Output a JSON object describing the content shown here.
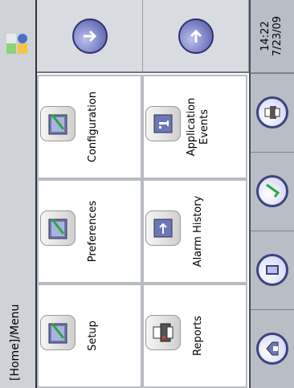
{
  "breadcrumb": {
    "text": "[Home]/Menu"
  },
  "menu": {
    "items": [
      {
        "label": "Setup",
        "icon": "setup-icon"
      },
      {
        "label": "Preferences",
        "icon": "preferences-icon"
      },
      {
        "label": "Configuration",
        "icon": "configuration-icon"
      },
      {
        "label": "Reports",
        "icon": "reports-icon"
      },
      {
        "label": "Alarm History",
        "icon": "alarm-history-icon"
      },
      {
        "label": "Application\nEvents",
        "icon": "application-events-icon"
      }
    ]
  },
  "side_nav": {
    "previous": "arrow-down-icon",
    "next": "arrow-right-icon"
  },
  "bottom_nav": [
    "home-icon",
    "keypad-icon",
    "check-icon",
    "printer-icon"
  ],
  "status_icon": "status-indicator-icon",
  "clock": {
    "time": "14:22",
    "date": "7/23/09"
  },
  "colors": {
    "accent": "#4a52a0",
    "breadcrumb_bg": "#cfd3d9",
    "bottom_bg": "#b9bec6"
  }
}
